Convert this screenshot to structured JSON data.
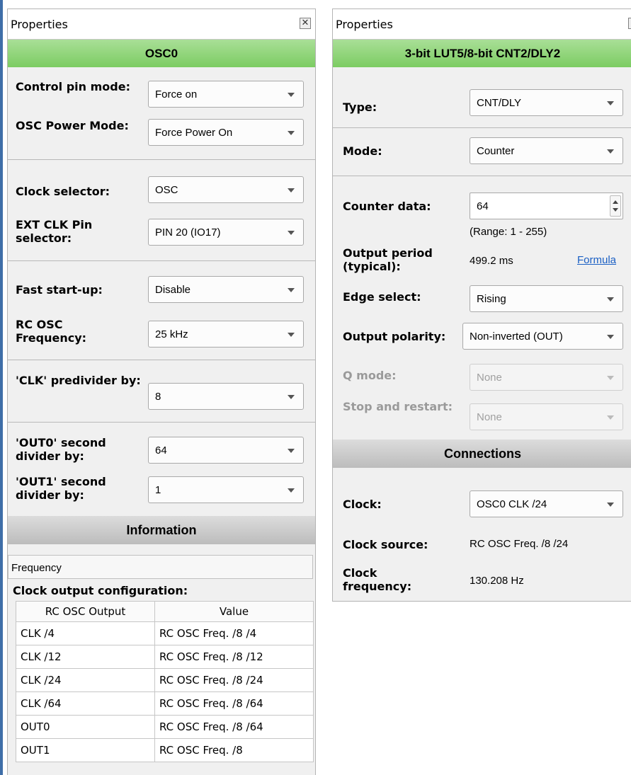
{
  "left": {
    "title": "Properties",
    "header": "OSC0",
    "fields": {
      "control_pin_mode": {
        "label": "Control pin mode:",
        "value": "Force on"
      },
      "osc_power_mode": {
        "label": "OSC Power Mode:",
        "value": "Force Power On"
      },
      "clock_selector": {
        "label": "Clock selector:",
        "value": "OSC"
      },
      "ext_clk_pin": {
        "label": "EXT CLK Pin selector:",
        "value": "PIN 20 (IO17)"
      },
      "fast_startup": {
        "label": "Fast start-up:",
        "value": "Disable"
      },
      "rc_osc_freq": {
        "label": "RC OSC Frequency:",
        "value": "25 kHz"
      },
      "clk_predivider": {
        "label": "'CLK' predivider by:",
        "value": "8"
      },
      "out0_divider": {
        "label": "'OUT0' second divider by:",
        "value": "64"
      },
      "out1_divider": {
        "label": "'OUT1' second divider by:",
        "value": "1"
      }
    },
    "info_header": "Information",
    "frequency_label": "Frequency",
    "table_title": "Clock output configuration:",
    "table": {
      "headers": [
        "RC OSC Output",
        "Value"
      ],
      "rows": [
        [
          "CLK /4",
          "RC OSC Freq. /8 /4"
        ],
        [
          "CLK /12",
          "RC OSC Freq. /8 /12"
        ],
        [
          "CLK /24",
          "RC OSC Freq. /8 /24"
        ],
        [
          "CLK /64",
          "RC OSC Freq. /8 /64"
        ],
        [
          "OUT0",
          "RC OSC Freq. /8 /64"
        ],
        [
          "OUT1",
          "RC OSC Freq. /8"
        ]
      ]
    }
  },
  "right": {
    "title": "Properties",
    "header": "3-bit LUT5/8-bit CNT2/DLY2",
    "fields": {
      "type": {
        "label": "Type:",
        "value": "CNT/DLY"
      },
      "mode": {
        "label": "Mode:",
        "value": "Counter"
      },
      "counter_data": {
        "label": "Counter data:",
        "value": "64",
        "range": "(Range:  1 - 255)"
      },
      "output_period": {
        "label": "Output period (typical):",
        "value": "499.2 ms",
        "link": "Formula"
      },
      "edge_select": {
        "label": "Edge select:",
        "value": "Rising"
      },
      "output_polarity": {
        "label": "Output polarity:",
        "value": "Non-inverted (OUT)"
      },
      "q_mode": {
        "label": "Q mode:",
        "value": "None"
      },
      "stop_restart": {
        "label": "Stop and restart:",
        "value": "None"
      }
    },
    "connections_header": "Connections",
    "connections": {
      "clock": {
        "label": "Clock:",
        "value": "OSC0 CLK /24"
      },
      "clock_source": {
        "label": "Clock source:",
        "value": "RC OSC Freq. /8 /24"
      },
      "clock_frequency": {
        "label": "Clock frequency:",
        "value": "130.208 Hz"
      }
    }
  },
  "colors": {
    "green_header": "#8fd679",
    "gray_header": "#cccccc",
    "link": "#1a5fc4",
    "panel_bg": "#f0f0f0"
  }
}
